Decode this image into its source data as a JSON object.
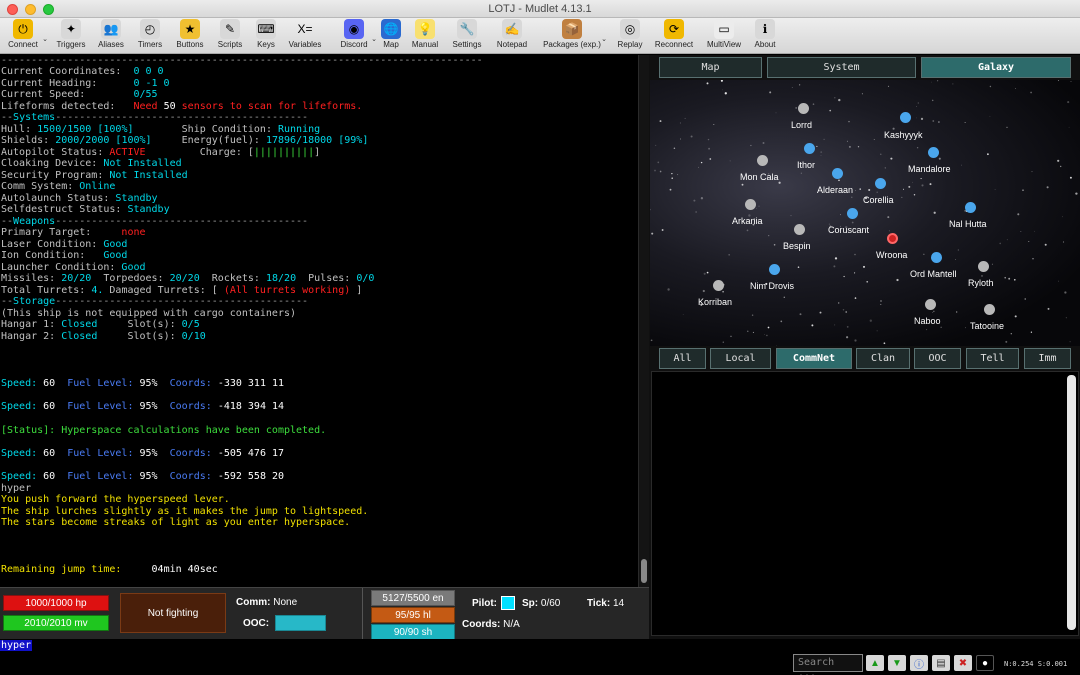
{
  "window": {
    "title": "LOTJ - Mudlet 4.13.1"
  },
  "toolbar": [
    {
      "label": "Connect",
      "icon": "connect-icon",
      "color": "#f0b800",
      "glyph": "⏻"
    },
    {
      "label": "Triggers",
      "icon": "triggers-icon",
      "color": "#d8d8d8",
      "glyph": "✦"
    },
    {
      "label": "Aliases",
      "icon": "aliases-icon",
      "color": "#d8d8d8",
      "glyph": "👥"
    },
    {
      "label": "Timers",
      "icon": "timers-icon",
      "color": "#d8d8d8",
      "glyph": "◴"
    },
    {
      "label": "Buttons",
      "icon": "buttons-icon",
      "color": "#f0c030",
      "glyph": "★"
    },
    {
      "label": "Scripts",
      "icon": "scripts-icon",
      "color": "#d8d8d8",
      "glyph": "✎"
    },
    {
      "label": "Keys",
      "icon": "keys-icon",
      "color": "#d8d8d8",
      "glyph": "⌨"
    },
    {
      "label": "Variables",
      "icon": "variables-icon",
      "color": "transparent",
      "glyph": "X="
    },
    {
      "label": "Discord",
      "icon": "discord-icon",
      "color": "#5865f2",
      "glyph": "◉"
    },
    {
      "label": "Map",
      "icon": "map-icon",
      "color": "#2a6ad0",
      "glyph": "🌐"
    },
    {
      "label": "Manual",
      "icon": "manual-icon",
      "color": "#f8e070",
      "glyph": "💡"
    },
    {
      "label": "Settings",
      "icon": "settings-icon",
      "color": "#d8d8d8",
      "glyph": "🔧"
    },
    {
      "label": "Notepad",
      "icon": "notepad-icon",
      "color": "#d8d8d8",
      "glyph": "✍"
    },
    {
      "label": "Packages (exp.)",
      "icon": "packages-icon",
      "color": "#c08040",
      "glyph": "📦"
    },
    {
      "label": "Replay",
      "icon": "replay-icon",
      "color": "#d8d8d8",
      "glyph": "◎"
    },
    {
      "label": "Reconnect",
      "icon": "reconnect-icon",
      "color": "#f0b800",
      "glyph": "⟳"
    },
    {
      "label": "MultiView",
      "icon": "multiview-icon",
      "color": "#ececec",
      "glyph": "▭"
    },
    {
      "label": "About",
      "icon": "about-icon",
      "color": "#d8d8d8",
      "glyph": "ℹ"
    }
  ],
  "console": {
    "separator": "--------------------------------------------------------------------------------",
    "coords_label": "Current Coordinates:",
    "coords_value": "0 0 0",
    "heading_label": "Current Heading:",
    "heading_value": "0 -1 0",
    "speed_label": "Current Speed:",
    "speed_value": "0/55",
    "lifeforms_label": "Lifeforms detected:",
    "lifeforms_need": "Need",
    "lifeforms_num": "50",
    "lifeforms_msg": "sensors to scan for lifeforms.",
    "systems_dash": "--",
    "systems_label": "Systems",
    "systems_tail": "------------------------------------------",
    "hull_label": "Hull:",
    "hull_value": "1500/1500",
    "hull_pct": "[100%]",
    "shipcond_label": "Ship Condition:",
    "shipcond_value": "Running",
    "shields_label": "Shields:",
    "shields_value": "2000/2000",
    "shields_pct": "[100%]",
    "energy_label": "Energy(fuel):",
    "energy_value": "17896/18000",
    "energy_pct": "[99%]",
    "autopilot_label": "Autopilot Status:",
    "autopilot_value": "ACTIVE",
    "charge_label": "Charge: [",
    "charge_value": "||||||||||",
    "charge_close": "]",
    "cloak_label": "Cloaking Device:",
    "cloak_value": "Not Installed",
    "security_label": "Security Program:",
    "security_value": "Not Installed",
    "comm_label": "Comm System:",
    "comm_value": "Online",
    "autolaunch_label": "Autolaunch Status:",
    "autolaunch_value": "Standby",
    "selfdestruct_label": "Selfdestruct Status:",
    "selfdestruct_value": "Standby",
    "weapons_label": "Weapons",
    "weapons_tail": "------------------------------------------",
    "primary_label": "Primary Target:",
    "primary_value": "none",
    "laser_label": "Laser Condition:",
    "laser_value": "Good",
    "ion_label": "Ion Condition:",
    "ion_value": "Good",
    "launcher_label": "Launcher Condition:",
    "launcher_value": "Good",
    "missiles_label": "Missiles:",
    "missiles_value": "20/20",
    "torpedoes_label": "Torpedoes:",
    "torpedoes_value": "20/20",
    "rockets_label": "Rockets:",
    "rockets_value": "18/20",
    "pulses_label": "Pulses:",
    "pulses_value": "0/0",
    "turrets_label": "Total Turrets:",
    "turrets_value": "4.",
    "damaged_label": "Damaged Turrets: [",
    "damaged_value": "(All turrets working)",
    "damaged_close": "]",
    "storage_label": "Storage",
    "storage_tail": "------------------------------------------",
    "cargo_msg": "(This ship is not equipped with cargo containers)",
    "hangar1_label": "Hangar 1:",
    "hangar1_value": "Closed",
    "slots1_label": "Slot(s):",
    "slots1_value": "0/5",
    "hangar2_label": "Hangar 2:",
    "hangar2_value": "Closed",
    "slots2_label": "Slot(s):",
    "slots2_value": "0/10",
    "speed_lines": [
      {
        "speed": "60",
        "fuel": "95%",
        "coords": "-330 311 11"
      },
      {
        "speed": "60",
        "fuel": "95%",
        "coords": "-418 394 14"
      },
      {
        "speed": "60",
        "fuel": "95%",
        "coords": "-505 476 17"
      },
      {
        "speed": "60",
        "fuel": "95%",
        "coords": "-592 558 20"
      }
    ],
    "speed_word": "Speed:",
    "fuel_word": "Fuel Level:",
    "coords_word": "Coords:",
    "status_msg": "[Status]: Hyperspace calculations have been completed.",
    "echo_cmd": "hyper",
    "push_msg": "You push forward the hyperspeed lever.",
    "lurch_msg": "The ship lurches slightly as it makes the jump to lightspeed.",
    "streak_msg": "The stars become streaks of light as you enter hyperspace.",
    "remaining_label": "Remaining jump time:",
    "remaining_value": "04min 40sec"
  },
  "statusbar": {
    "hp": "1000/1000 hp",
    "hp_pct": 100,
    "mv": "2010/2010 mv",
    "mv_pct": 100,
    "fighting": "Not fighting",
    "comm_label": "Comm:",
    "comm_value": "None",
    "ooc_label": "OOC:",
    "en": "5127/5500 en",
    "hl": "95/95 hl",
    "sh": "90/90 sh",
    "pilot_label": "Pilot:",
    "sp_label": "Sp:",
    "sp_value": "0/60",
    "tick_label": "Tick:",
    "tick_value": "14",
    "coords_label": "Coords:",
    "coords_value": "N/A"
  },
  "command_input": {
    "value": "hyper"
  },
  "bottombar": {
    "search_placeholder": "Search ...",
    "net": "N:0.254 S:0.001"
  },
  "map_tabs": [
    {
      "label": "Map",
      "active": false
    },
    {
      "label": "System",
      "active": false
    },
    {
      "label": "Galaxy",
      "active": true
    }
  ],
  "galaxy": {
    "planets": [
      {
        "name": "Lorrd",
        "kind": "grey"
      },
      {
        "name": "Kashyyyk",
        "kind": "blue"
      },
      {
        "name": "Ithor",
        "kind": "blue"
      },
      {
        "name": "Mandalore",
        "kind": "blue"
      },
      {
        "name": "Mon Cala",
        "kind": "grey"
      },
      {
        "name": "Alderaan",
        "kind": "blue"
      },
      {
        "name": "Corellia",
        "kind": "blue"
      },
      {
        "name": "Arkania",
        "kind": "grey"
      },
      {
        "name": "Coruscant",
        "kind": "blue"
      },
      {
        "name": "Nal Hutta",
        "kind": "blue"
      },
      {
        "name": "Bespin",
        "kind": "grey"
      },
      {
        "name": "Wroona",
        "kind": "red"
      },
      {
        "name": "Ord Mantell",
        "kind": "blue"
      },
      {
        "name": "Ryloth",
        "kind": "grey"
      },
      {
        "name": "Nim Drovis",
        "kind": "blue"
      },
      {
        "name": "Korriban",
        "kind": "grey"
      },
      {
        "name": "Naboo",
        "kind": "grey"
      },
      {
        "name": "Tatooine",
        "kind": "grey"
      }
    ]
  },
  "chat_tabs": [
    {
      "label": "All",
      "active": false
    },
    {
      "label": "Local",
      "active": false
    },
    {
      "label": "CommNet",
      "active": true
    },
    {
      "label": "Clan",
      "active": false
    },
    {
      "label": "OOC",
      "active": false
    },
    {
      "label": "Tell",
      "active": false
    },
    {
      "label": "Imm",
      "active": false
    }
  ]
}
